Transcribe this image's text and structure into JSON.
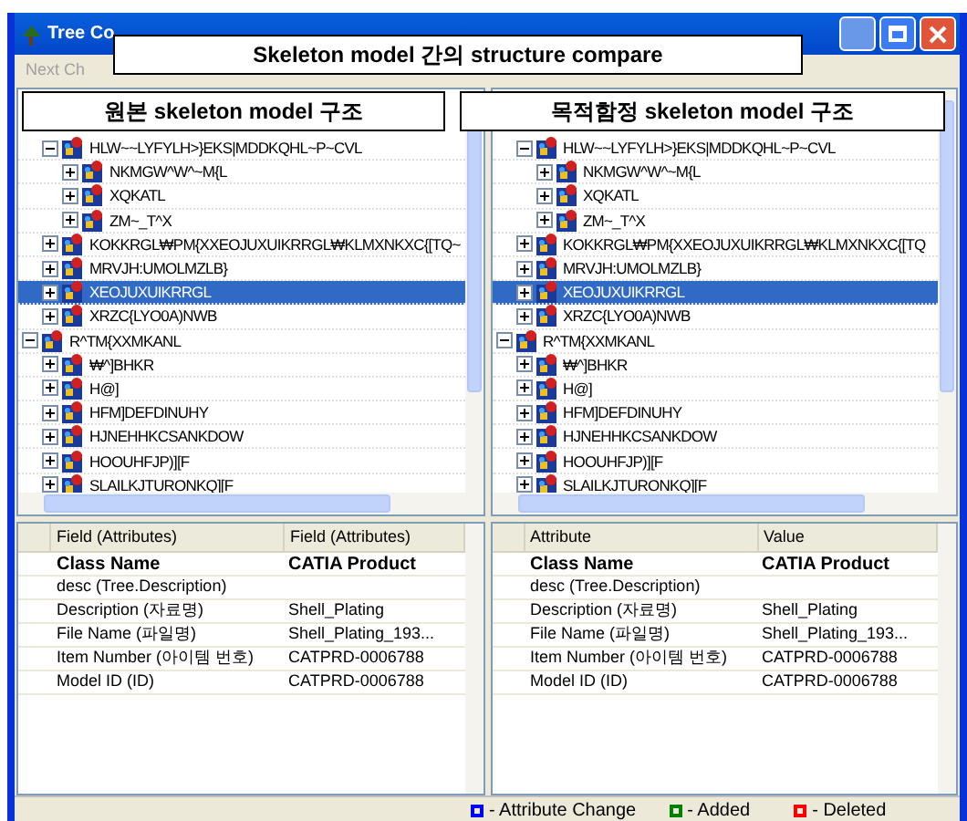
{
  "window": {
    "title": "Tree Co"
  },
  "toolbar": {
    "button": "Next Ch"
  },
  "callout": "Skeleton model 간의 structure compare",
  "panes": [
    {
      "header": "원본 skeleton model 구조",
      "tree": [
        {
          "children": [
            {
              "label": "HLW~~LYFYLH>}EKS|MDDKQHL~P~CVL",
              "expanded": true,
              "selected": false,
              "children": [
                {
                  "label": "NKMGW^W^~M{L",
                  "expanded": false,
                  "selected": false
                },
                {
                  "label": "XQKATL",
                  "expanded": false,
                  "selected": false
                },
                {
                  "label": "ZM~_T^X",
                  "expanded": false,
                  "selected": false
                }
              ]
            },
            {
              "label": "KOKKRGL₩PM{XXEOJUXUIKRRGL₩KLMXNKXC{[TQ~",
              "expanded": false,
              "selected": false
            },
            {
              "label": "MRVJH:UMOLMZLB}",
              "expanded": false,
              "selected": false
            },
            {
              "label": "XEOJUXUIKRRGL",
              "expanded": false,
              "selected": true
            },
            {
              "label": "XRZC{LYO0A)NWB",
              "expanded": false,
              "selected": false
            }
          ]
        },
        {
          "label": "R^TM{XXMKANL",
          "expanded": true,
          "selected": false,
          "children": [
            {
              "label": "₩^]BHKR",
              "expanded": false,
              "selected": false
            },
            {
              "label": "H@]",
              "expanded": false,
              "selected": false
            },
            {
              "label": "HFM]DEFDINUHY",
              "expanded": false,
              "selected": false
            },
            {
              "label": "HJNEHHKCSANKDOW",
              "expanded": false,
              "selected": false
            },
            {
              "label": "HOOUHFJP)][F",
              "expanded": false,
              "selected": false
            },
            {
              "label": "SLAILKJTURONKQ][F",
              "expanded": false,
              "selected": false
            }
          ]
        }
      ],
      "grid": {
        "columns": [
          "Field (Attributes)",
          "Field (Attributes)"
        ],
        "rows": [
          {
            "field": "Class Name",
            "value": "CATIA Product",
            "bold": true
          },
          {
            "field": "desc (Tree.Description)",
            "bold": false
          },
          {
            "field": "Description (자료명)",
            "value": "Shell_Plating",
            "bold": false
          },
          {
            "field": "File Name (파일명)",
            "value": "Shell_Plating_193...",
            "bold": false
          },
          {
            "field": "Item Number (아이템 번호)",
            "value": "CATPRD-0006788",
            "bold": false
          },
          {
            "field": "Model ID (ID)",
            "value": "CATPRD-0006788",
            "bold": false
          }
        ]
      }
    },
    {
      "header": "목적함정 skeleton model 구조",
      "tree": [
        {
          "children": [
            {
              "label": "HLW~~LYFYLH>}EKS|MDDKQHL~P~CVL",
              "expanded": true,
              "selected": false,
              "children": [
                {
                  "label": "NKMGW^W^~M{L",
                  "expanded": false,
                  "selected": false
                },
                {
                  "label": "XQKATL",
                  "expanded": false,
                  "selected": false
                },
                {
                  "label": "ZM~_T^X",
                  "expanded": false,
                  "selected": false
                }
              ]
            },
            {
              "label": "KOKKRGL₩PM{XXEOJUXUIKRRGL₩KLMXNKXC{[TQ",
              "expanded": false,
              "selected": false
            },
            {
              "label": "MRVJH:UMOLMZLB}",
              "expanded": false,
              "selected": false
            },
            {
              "label": "XEOJUXUIKRRGL",
              "expanded": false,
              "selected": true
            },
            {
              "label": "XRZC{LYO0A)NWB",
              "expanded": false,
              "selected": false
            }
          ]
        },
        {
          "label": "R^TM{XXMKANL",
          "expanded": true,
          "selected": false,
          "children": [
            {
              "label": "₩^]BHKR",
              "expanded": false,
              "selected": false
            },
            {
              "label": "H@]",
              "expanded": false,
              "selected": false
            },
            {
              "label": "HFM]DEFDINUHY",
              "expanded": false,
              "selected": false
            },
            {
              "label": "HJNEHHKCSANKDOW",
              "expanded": false,
              "selected": false
            },
            {
              "label": "HOOUHFJP)][F",
              "expanded": false,
              "selected": false
            },
            {
              "label": "SLAILKJTURONKQ][F",
              "expanded": false,
              "selected": false
            }
          ]
        }
      ],
      "grid": {
        "columns": [
          "Attribute",
          "Value"
        ],
        "rows": [
          {
            "field": "Class Name",
            "value": "CATIA Product",
            "bold": true
          },
          {
            "field": "desc (Tree.Description)",
            "bold": false
          },
          {
            "field": "Description (자료명)",
            "value": "Shell_Plating",
            "bold": false
          },
          {
            "field": "File Name (파일명)",
            "value": "Shell_Plating_193...",
            "bold": false
          },
          {
            "field": "Item Number (아이템 번호)",
            "value": "CATPRD-0006788",
            "bold": false
          },
          {
            "field": "Model ID (ID)",
            "value": "CATPRD-0006788",
            "bold": false
          }
        ]
      }
    }
  ],
  "legend": [
    {
      "label": "- Attribute Change",
      "color": "#0000ff"
    },
    {
      "label": "- Added",
      "color": "#008000"
    },
    {
      "label": "- Deleted",
      "color": "#ff0000"
    }
  ]
}
